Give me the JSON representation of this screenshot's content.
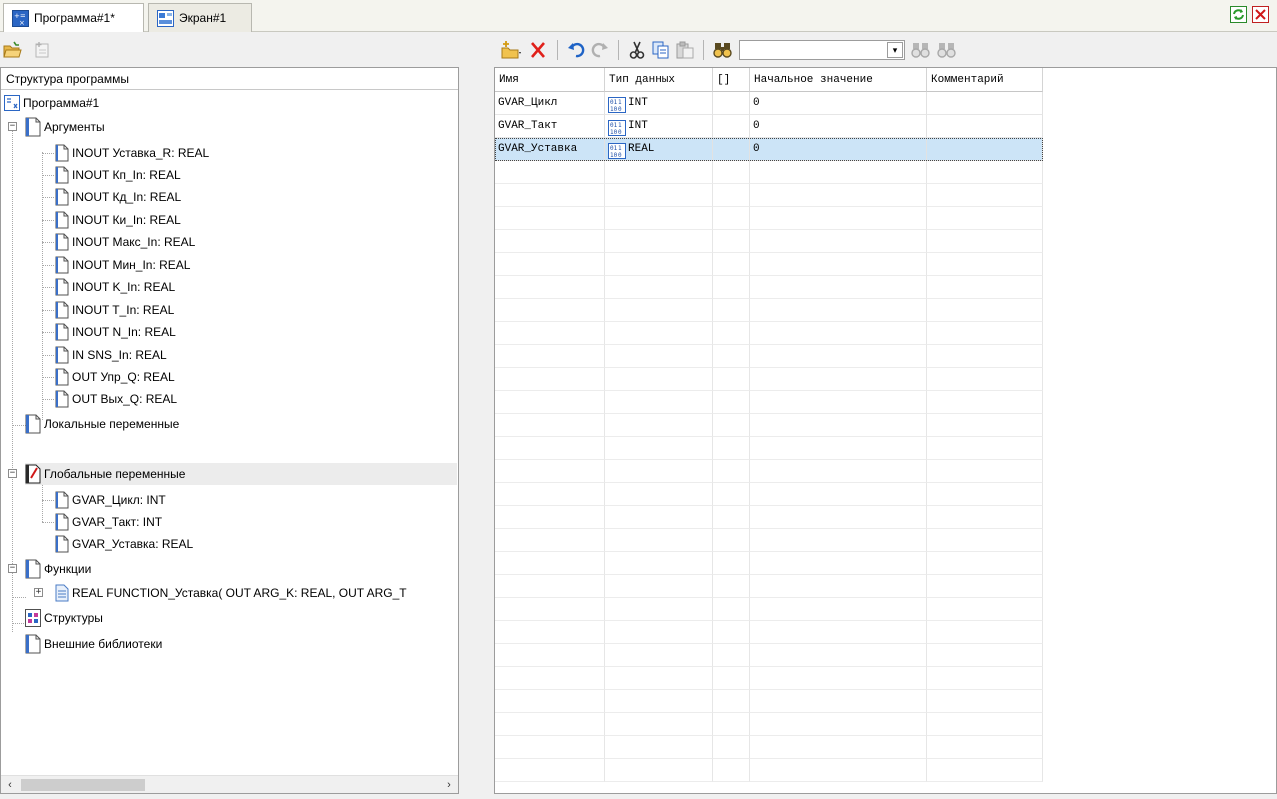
{
  "tabs": [
    {
      "label": "Программа#1*",
      "icon": "program-icon",
      "active": true
    },
    {
      "label": "Экран#1",
      "icon": "screen-icon",
      "active": false
    }
  ],
  "left": {
    "header": "Структура программы",
    "tree": [
      {
        "label": "Программа#1",
        "icon": "program-icon",
        "level": 0
      },
      {
        "label": "Аргументы",
        "icon": "page-icon",
        "level": 1,
        "expanded": true
      },
      {
        "label": "INOUT Уставка_R: REAL",
        "icon": "page-icon",
        "level": 2
      },
      {
        "label": "INOUT Кп_In: REAL",
        "icon": "page-icon",
        "level": 2
      },
      {
        "label": "INOUT Кд_In: REAL",
        "icon": "page-icon",
        "level": 2
      },
      {
        "label": "INOUT Ки_In: REAL",
        "icon": "page-icon",
        "level": 2
      },
      {
        "label": "INOUT Макс_In: REAL",
        "icon": "page-icon",
        "level": 2
      },
      {
        "label": "INOUT Мин_In: REAL",
        "icon": "page-icon",
        "level": 2
      },
      {
        "label": "INOUT K_In: REAL",
        "icon": "page-icon",
        "level": 2
      },
      {
        "label": "INOUT T_In: REAL",
        "icon": "page-icon",
        "level": 2
      },
      {
        "label": "INOUT N_In: REAL",
        "icon": "page-icon",
        "level": 2
      },
      {
        "label": "IN SNS_In: REAL",
        "icon": "page-icon",
        "level": 2
      },
      {
        "label": "OUT Упр_Q: REAL",
        "icon": "page-icon",
        "level": 2
      },
      {
        "label": "OUT Вых_Q: REAL",
        "icon": "page-icon",
        "level": 2
      },
      {
        "label": "Локальные переменные",
        "icon": "page-icon",
        "level": 1
      },
      {
        "label": "Глобальные переменные",
        "icon": "global-vars-icon",
        "level": 1,
        "expanded": true,
        "selected": true
      },
      {
        "label": "GVAR_Цикл: INT",
        "icon": "page-icon",
        "level": 2
      },
      {
        "label": "GVAR_Такт: INT",
        "icon": "page-icon",
        "level": 2
      },
      {
        "label": "GVAR_Уставка: REAL",
        "icon": "page-icon",
        "level": 2
      },
      {
        "label": "Функции",
        "icon": "page-icon",
        "level": 1,
        "expanded": true
      },
      {
        "label": "REAL FUNCTION_Уставка( OUT ARG_K: REAL, OUT ARG_T",
        "icon": "function-icon",
        "level": 2,
        "collapsed": true
      },
      {
        "label": "Структуры",
        "icon": "struct-icon",
        "level": 1
      },
      {
        "label": "Внешние библиотеки",
        "icon": "page-icon",
        "level": 1
      }
    ]
  },
  "table": {
    "columns": [
      "Имя",
      "Тип данных",
      "[]",
      "Начальное значение",
      "Комментарий"
    ],
    "rows": [
      {
        "name": "GVAR_Цикл",
        "type": "INT",
        "array": "",
        "init": "0",
        "comment": ""
      },
      {
        "name": "GVAR_Такт",
        "type": "INT",
        "array": "",
        "init": "0",
        "comment": ""
      },
      {
        "name": "GVAR_Уставка",
        "type": "REAL",
        "array": "",
        "init": "0",
        "comment": "",
        "selected": true
      }
    ],
    "search_value": ""
  },
  "toolbar_icons": {
    "left": [
      "open-folder-icon",
      "add-item-icon"
    ],
    "right": [
      "add-variable-icon",
      "dropdown-arrow-icon",
      "delete-icon",
      "undo-icon",
      "redo-icon",
      "cut-icon",
      "copy-icon",
      "paste-icon",
      "find-icon",
      "find-next-icon",
      "find-prev-icon"
    ],
    "window": [
      "refresh-icon",
      "close-icon"
    ]
  },
  "colors": {
    "selection": "#cce4f7",
    "delete": "#e0201a",
    "accent": "#1f63c6"
  }
}
